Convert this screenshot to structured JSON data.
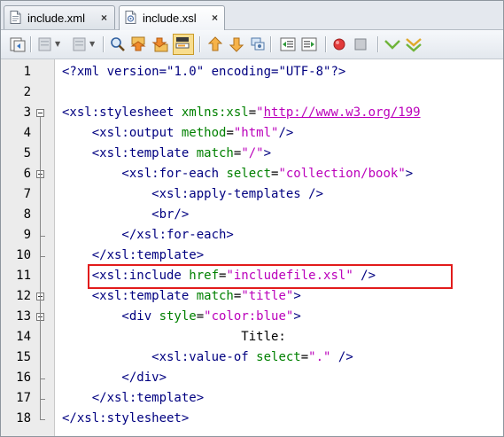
{
  "tabs": [
    {
      "label": "include.xml",
      "close": "×",
      "active": false
    },
    {
      "label": "include.xsl",
      "close": "×",
      "active": true
    }
  ],
  "toolbar": {
    "icons": [
      "history-icon",
      "back-icon",
      "forward-icon",
      "find-icon",
      "find-previous-icon",
      "find-next-icon",
      "toggle-highlight-icon",
      "previous-bookmark-icon",
      "next-bookmark-icon",
      "toggle-bookmark-icon",
      "shift-left-icon",
      "shift-right-icon",
      "record-macro-icon",
      "stop-macro-icon",
      "check-xml-icon",
      "validate-xml-icon"
    ],
    "dropdown_glyph": "▼"
  },
  "editor": {
    "line_numbers": [
      "1",
      "2",
      "3",
      "4",
      "5",
      "6",
      "7",
      "8",
      "9",
      "10",
      "11",
      "12",
      "13",
      "14",
      "15",
      "16",
      "17",
      "18"
    ],
    "lines": [
      [
        {
          "s": "<?",
          "c": "t"
        },
        {
          "s": "xml",
          "c": "t"
        },
        {
          "s": " version=\"1.0\" encoding=\"UTF-8\"?>",
          "c": "t"
        }
      ],
      [],
      [
        {
          "s": "<xsl:stylesheet ",
          "c": "t"
        },
        {
          "s": "xmlns:xsl",
          "c": "a"
        },
        {
          "s": "=",
          "c": "p"
        },
        {
          "s": "\"",
          "c": "v"
        },
        {
          "s": "http://www.w3.org/199",
          "c": "u"
        }
      ],
      [
        {
          "s": "    <xsl:output ",
          "c": "t"
        },
        {
          "s": "method",
          "c": "a"
        },
        {
          "s": "=",
          "c": "p"
        },
        {
          "s": "\"html\"",
          "c": "v"
        },
        {
          "s": "/>",
          "c": "t"
        }
      ],
      [
        {
          "s": "    <xsl:template ",
          "c": "t"
        },
        {
          "s": "match",
          "c": "a"
        },
        {
          "s": "=",
          "c": "p"
        },
        {
          "s": "\"/\"",
          "c": "v"
        },
        {
          "s": ">",
          "c": "t"
        }
      ],
      [
        {
          "s": "        <xsl:for-each ",
          "c": "t"
        },
        {
          "s": "select",
          "c": "a"
        },
        {
          "s": "=",
          "c": "p"
        },
        {
          "s": "\"collection/book\"",
          "c": "v"
        },
        {
          "s": ">",
          "c": "t"
        }
      ],
      [
        {
          "s": "            <xsl:apply-templates />",
          "c": "t"
        }
      ],
      [
        {
          "s": "            <br/>",
          "c": "t"
        }
      ],
      [
        {
          "s": "        </xsl:for-each>",
          "c": "t"
        }
      ],
      [
        {
          "s": "    </xsl:template>",
          "c": "t"
        }
      ],
      [
        {
          "s": "    <xsl:include ",
          "c": "t"
        },
        {
          "s": "href",
          "c": "a"
        },
        {
          "s": "=",
          "c": "p"
        },
        {
          "s": "\"includefile.xsl\"",
          "c": "v"
        },
        {
          "s": " />",
          "c": "t"
        }
      ],
      [
        {
          "s": "    <xsl:template ",
          "c": "t"
        },
        {
          "s": "match",
          "c": "a"
        },
        {
          "s": "=",
          "c": "p"
        },
        {
          "s": "\"title\"",
          "c": "v"
        },
        {
          "s": ">",
          "c": "t"
        }
      ],
      [
        {
          "s": "        <div ",
          "c": "t"
        },
        {
          "s": "style",
          "c": "a"
        },
        {
          "s": "=",
          "c": "p"
        },
        {
          "s": "\"color:blue\"",
          "c": "v"
        },
        {
          "s": ">",
          "c": "t"
        }
      ],
      [
        {
          "s": "                        Title:",
          "c": "p"
        }
      ],
      [
        {
          "s": "            <xsl:value-of ",
          "c": "t"
        },
        {
          "s": "select",
          "c": "a"
        },
        {
          "s": "=",
          "c": "p"
        },
        {
          "s": "\".\"",
          "c": "v"
        },
        {
          "s": " />",
          "c": "t"
        }
      ],
      [
        {
          "s": "        </div>",
          "c": "t"
        }
      ],
      [
        {
          "s": "    </xsl:template>",
          "c": "t"
        }
      ],
      [
        {
          "s": "</xsl:stylesheet>",
          "c": "t"
        }
      ]
    ],
    "highlighted_line": 11
  },
  "colors": {
    "tag": "#000080",
    "attribute": "#008000",
    "value": "#bb00bb",
    "highlight_box": "#e21b1b"
  }
}
